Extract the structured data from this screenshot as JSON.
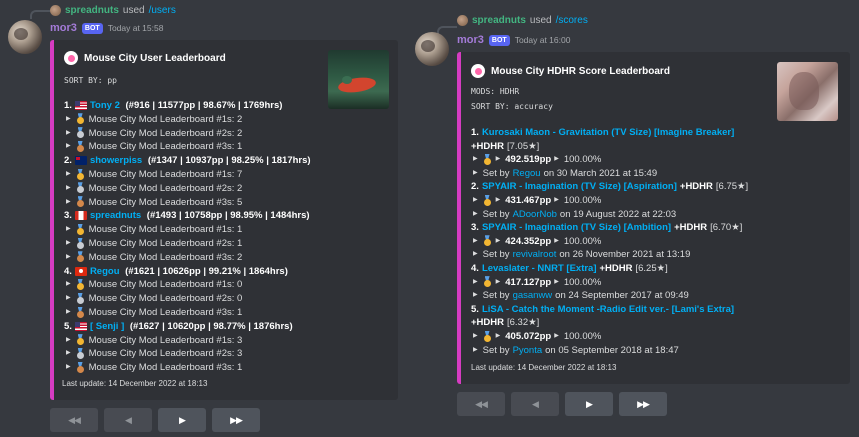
{
  "left": {
    "reply": {
      "user": "spreadnuts",
      "used": "used",
      "command": "/users"
    },
    "author": "mor3",
    "bot_tag": "BOT",
    "timestamp": "Today at 15:58",
    "embed": {
      "title": "Mouse City User Leaderboard",
      "sort": "SORT BY: pp",
      "entries": [
        {
          "rank": "1.",
          "flag": "us",
          "name": "Tony 2",
          "stats": " (#916 | 11577pp | 98.67% | 1769hrs)",
          "lines": [
            "Mouse City Mod Leaderboard #1s: 2",
            "Mouse City Mod Leaderboard #2s: 2",
            "Mouse City Mod Leaderboard #3s: 1"
          ]
        },
        {
          "rank": "2.",
          "flag": "au",
          "name": "showerpiss",
          "stats": " (#1347 | 10937pp | 98.25% | 1817hrs)",
          "lines": [
            "Mouse City Mod Leaderboard #1s: 7",
            "Mouse City Mod Leaderboard #2s: 2",
            "Mouse City Mod Leaderboard #3s: 5"
          ]
        },
        {
          "rank": "3.",
          "flag": "ca",
          "name": "spreadnuts",
          "stats": " (#1493 | 10758pp | 98.95% | 1484hrs)",
          "lines": [
            "Mouse City Mod Leaderboard #1s: 1",
            "Mouse City Mod Leaderboard #2s: 1",
            "Mouse City Mod Leaderboard #3s: 2"
          ]
        },
        {
          "rank": "4.",
          "flag": "hk",
          "name": "Regou",
          "stats": " (#1621 | 10626pp | 99.21% | 1864hrs)",
          "lines": [
            "Mouse City Mod Leaderboard #1s: 0",
            "Mouse City Mod Leaderboard #2s: 0",
            "Mouse City Mod Leaderboard #3s: 1"
          ]
        },
        {
          "rank": "5.",
          "flag": "us",
          "name": "[ Senji ]",
          "stats": " (#1627 | 10620pp | 98.77% | 1876hrs)",
          "lines": [
            "Mouse City Mod Leaderboard #1s: 3",
            "Mouse City Mod Leaderboard #2s: 3",
            "Mouse City Mod Leaderboard #3s: 1"
          ]
        }
      ],
      "footer": "Last update: 14 December 2022 at 18:13"
    },
    "buttons": [
      "◀◀",
      "◀",
      "▶",
      "▶▶"
    ]
  },
  "right": {
    "reply": {
      "user": "spreadnuts",
      "used": "used",
      "command": "/scores"
    },
    "author": "mor3",
    "bot_tag": "BOT",
    "timestamp": "Today at 16:00",
    "embed": {
      "title": "Mouse City HDHR Score Leaderboard",
      "mods": "MODS: HDHR",
      "sort": "SORT BY: accuracy",
      "entries": [
        {
          "rank": "1.",
          "song": "Kurosaki Maon - Gravitation (TV Size) [Imagine Breaker]",
          "mods": "+HDHR",
          "stars": "[7.05★]",
          "pp": "492.519pp",
          "acc": "100.00%",
          "set_by_prefix": "Set by",
          "player": "Regou",
          "date": "on 30 March 2021 at 15:49"
        },
        {
          "rank": "2.",
          "song": "SPYAIR - Imagination (TV Size) [Aspiration]",
          "mods": "+HDHR",
          "stars": "[6.75★]",
          "pp": "431.467pp",
          "acc": "100.00%",
          "set_by_prefix": "Set by",
          "player": "ADoorNob",
          "date": "on 19 August 2022 at 22:03"
        },
        {
          "rank": "3.",
          "song": "SPYAIR - Imagination (TV Size) [Ambition]",
          "mods": "+HDHR",
          "stars": "[6.70★]",
          "pp": "424.352pp",
          "acc": "100.00%",
          "set_by_prefix": "Set by",
          "player": "revivalroot",
          "date": "on 26 November 2021 at 13:19"
        },
        {
          "rank": "4.",
          "song": "Levaslater - NNRT [Extra]",
          "mods": "+HDHR",
          "stars": "[6.25★]",
          "pp": "417.127pp",
          "acc": "100.00%",
          "set_by_prefix": "Set by",
          "player": "gasanww",
          "date": "on 24 September 2017 at 09:49"
        },
        {
          "rank": "5.",
          "song": "LiSA - Catch the Moment -Radio Edit ver.- [Lami's Extra]",
          "mods": "+HDHR",
          "stars": "[6.32★]",
          "pp": "405.072pp",
          "acc": "100.00%",
          "set_by_prefix": "Set by",
          "player": "Pyonta",
          "date": "on 05 September 2018 at 18:47"
        }
      ],
      "footer": "Last update: 14 December 2022 at 18:13"
    },
    "buttons": [
      "◀◀",
      "◀",
      "▶",
      "▶▶"
    ]
  },
  "colors": {
    "accent": "#d63cc2",
    "link": "#00aff4",
    "author": "#a47bd8",
    "bot": "#5865f2",
    "reply_user": "#43b581"
  }
}
